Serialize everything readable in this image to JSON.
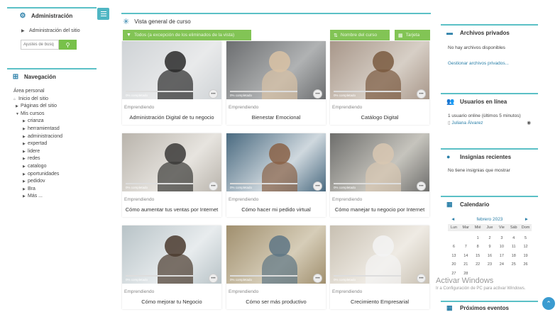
{
  "admin": {
    "title": "Administración",
    "site_admin": "Administración del sitio",
    "search_placeholder": "Ajustes de búsq"
  },
  "nav": {
    "title": "Navegación",
    "personal": "Área personal",
    "home": "Inicio del sitio",
    "site_pages": "Páginas del sitio",
    "my_courses": "Mis cursos",
    "courses": [
      "crianza",
      "herramientasd",
      "administraciond",
      "expertad",
      "lidere",
      "redes",
      "catalogo",
      "oportunidades",
      "pedidov",
      "Bra"
    ],
    "more": "Más ..."
  },
  "main": {
    "title": "Vista general de curso",
    "filter_label": "Todos (a excepción de los eliminados de la vista)",
    "sort_label": "Nombre del curso",
    "view_label": "Tarjeta",
    "progress_suffix": "completado",
    "cards": [
      {
        "category": "Emprendiendo",
        "title": "Administración Digital de tu negocio",
        "progress": "0%"
      },
      {
        "category": "Emprendiendo",
        "title": "Bienestar Emocional",
        "progress": "0%"
      },
      {
        "category": "Emprendiendo",
        "title": "Catálogo Digital",
        "progress": "0%"
      },
      {
        "category": "Emprendiendo",
        "title": "Cómo aumentar tus ventas por Internet",
        "progress": "0%"
      },
      {
        "category": "Emprendiendo",
        "title": "Cómo hacer mi pedido virtual",
        "progress": "0%"
      },
      {
        "category": "Emprendiendo",
        "title": "Cómo manejar tu negocio por Internet",
        "progress": "0%"
      },
      {
        "category": "Emprendiendo",
        "title": "Cómo mejorar tu Negocio",
        "progress": "0%"
      },
      {
        "category": "Emprendiendo",
        "title": "Cómo ser más productivo",
        "progress": "0%"
      },
      {
        "category": "Emprendiendo",
        "title": "Crecimiento Empresarial",
        "progress": "0%"
      }
    ]
  },
  "right": {
    "files_title": "Archivos privados",
    "files_empty": "No hay archivos disponibles",
    "files_manage": "Gestionar archivos privados...",
    "online_title": "Usuarios en línea",
    "online_count": "1 usuario online (últimos 5 minutos)",
    "online_user": "Juliana Álvarez",
    "badges_title": "Insignias recientes",
    "badges_empty": "No tiene insignias que mostrar",
    "calendar_title": "Calendario",
    "calendar_month": "febrero 2023",
    "calendar_prev": "◄",
    "calendar_next": "►",
    "calendar_days": [
      "Lun",
      "Mar",
      "Mié",
      "Jue",
      "Vie",
      "Sáb",
      "Dom"
    ],
    "calendar_rows": [
      [
        "",
        "",
        "1",
        "2",
        "3",
        "4",
        "5"
      ],
      [
        "6",
        "7",
        "8",
        "9",
        "10",
        "11",
        "12"
      ],
      [
        "13",
        "14",
        "15",
        "16",
        "17",
        "18",
        "19"
      ],
      [
        "20",
        "21",
        "22",
        "23",
        "24",
        "25",
        "26"
      ],
      [
        "27",
        "28",
        "",
        "",
        "",
        "",
        ""
      ]
    ],
    "events_title": "Próximos eventos"
  },
  "watermark": {
    "line1": "Activar Windows",
    "line2": "Ir a Configuración de PC para activar Windows."
  }
}
